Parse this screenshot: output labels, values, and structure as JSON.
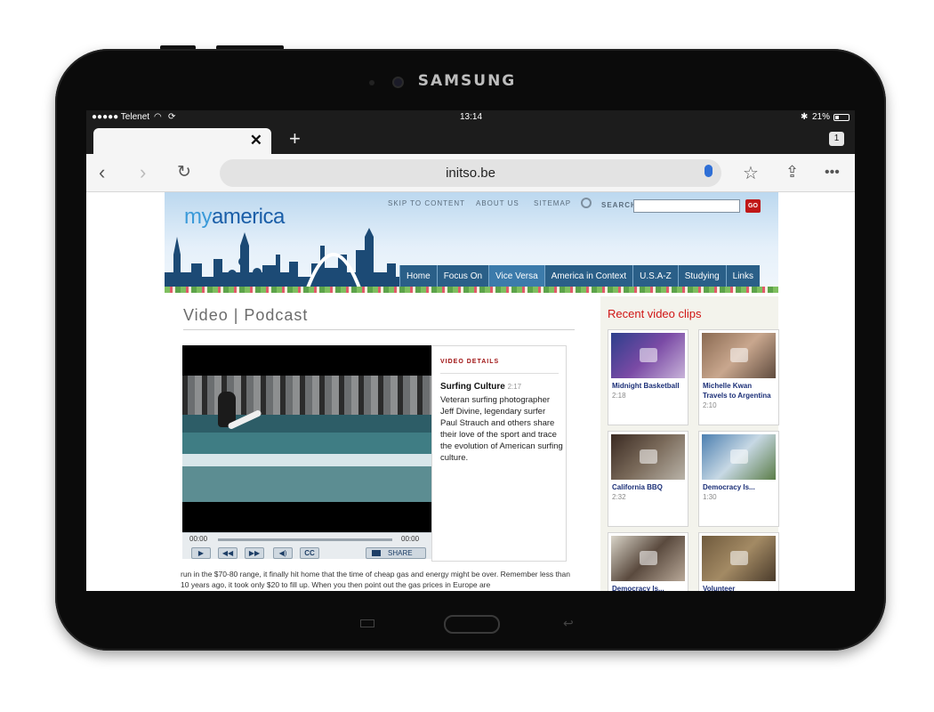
{
  "device": {
    "brand": "SAMSUNG"
  },
  "status_bar": {
    "carrier": "●●●●● Telenet",
    "time": "13:14",
    "battery": "21%"
  },
  "browser": {
    "tab_count": "1",
    "url": "initso.be",
    "icons": [
      "back-icon",
      "forward-icon",
      "reload-icon",
      "mic-icon",
      "star-icon",
      "share-icon",
      "more-icon"
    ]
  },
  "site": {
    "logo": {
      "my": "my",
      "america": "america"
    },
    "top_links": {
      "skip": "SKIP TO CONTENT",
      "about": "ABOUT US",
      "sitemap": "SITEMAP",
      "search": "SEARCH",
      "go": "GO"
    },
    "nav": [
      "Home",
      "Focus On",
      "Vice Versa",
      "America in Context",
      "U.S.A-Z",
      "Studying",
      "Links"
    ],
    "active_nav": "Vice Versa",
    "page_title": "Video | Podcast",
    "player": {
      "time_start": "00:00",
      "time_end": "00:00",
      "cc": "CC",
      "share": "SHARE"
    },
    "details": {
      "heading": "VIDEO DETAILS",
      "title": "Surfing Culture",
      "duration": "2:17",
      "description": "Veteran surfing photographer Jeff Divine, legendary surfer Paul Strauch and others share their love of the sport and trace the evolution of American surfing culture."
    },
    "body_text": "run in the $70-80 range, it finally hit home that the time of cheap gas and energy might be over. Remember less than 10 years ago, it took only $20 to fill up. When you then point out the gas prices in Europe are",
    "sidebar": {
      "heading": "Recent video clips",
      "clips": [
        {
          "title": "Midnight Basketball",
          "duration": "2:18"
        },
        {
          "title": "Michelle Kwan Travels to Argentina",
          "duration": "2:10"
        },
        {
          "title": "California BBQ",
          "duration": "2:32"
        },
        {
          "title": "Democracy Is...",
          "duration": "1:30"
        },
        {
          "title": "Democracy Is...",
          "duration": ""
        },
        {
          "title": "Volunteer",
          "duration": ""
        }
      ]
    }
  },
  "colors": {
    "accent_red": "#c01818",
    "nav_blue": "#2a5f88",
    "link_blue": "#1b2f77"
  }
}
